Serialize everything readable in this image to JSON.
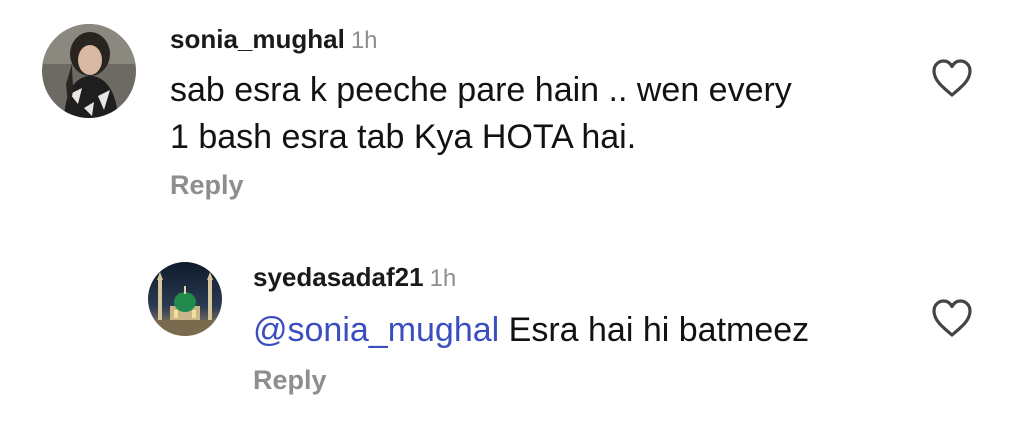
{
  "comment": {
    "username": "sonia_mughal",
    "time": "1h",
    "text_line1": "sab esra k peeche pare hain .. wen every",
    "text_line2": "1 bash esra tab Kya HOTA hai.",
    "reply_label": "Reply",
    "avatar_icon": "user-photo-avatar",
    "like_icon": "heart-outline-icon"
  },
  "reply": {
    "username": "syedasadaf21",
    "time": "1h",
    "mention": "@sonia_mughal",
    "text": " Esra hai hi batmeez",
    "reply_label": "Reply",
    "avatar_icon": "mosque-photo-avatar",
    "like_icon": "heart-outline-icon"
  },
  "colors": {
    "mention": "#3b4ec0",
    "muted": "#8e8e8e",
    "text": "#121212"
  }
}
